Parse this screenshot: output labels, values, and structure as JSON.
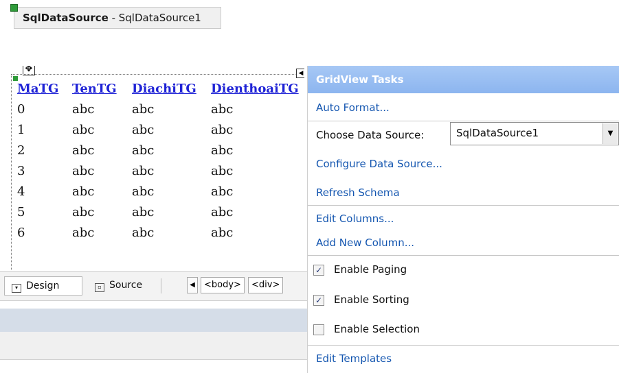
{
  "data_source": {
    "type": "SqlDataSource",
    "name": "SqlDataSource1",
    "separator": " - "
  },
  "grid": {
    "columns": [
      "MaTG",
      "TenTG",
      "DiachiTG",
      "DienthoaiTG"
    ],
    "rows": [
      [
        "0",
        "abc",
        "abc",
        "abc"
      ],
      [
        "1",
        "abc",
        "abc",
        "abc"
      ],
      [
        "2",
        "abc",
        "abc",
        "abc"
      ],
      [
        "3",
        "abc",
        "abc",
        "abc"
      ],
      [
        "4",
        "abc",
        "abc",
        "abc"
      ],
      [
        "5",
        "abc",
        "abc",
        "abc"
      ],
      [
        "6",
        "abc",
        "abc",
        "abc"
      ]
    ]
  },
  "view_bar": {
    "design_label": "Design",
    "source_label": "Source",
    "crumbs": [
      "<body>",
      "<div>"
    ]
  },
  "tasks": {
    "title": "GridView Tasks",
    "auto_format": "Auto Format...",
    "choose_ds_label": "Choose Data Source:",
    "choose_ds_value": "SqlDataSource1",
    "configure_ds": "Configure Data Source...",
    "refresh_schema": "Refresh Schema",
    "edit_columns": "Edit Columns...",
    "add_column": "Add New Column...",
    "enable_paging": {
      "label": "Enable Paging",
      "checked": true
    },
    "enable_sorting": {
      "label": "Enable Sorting",
      "checked": true
    },
    "enable_selection": {
      "label": "Enable Selection",
      "checked": false
    },
    "edit_templates": "Edit Templates"
  },
  "colors": {
    "header_bg": "#a7c8f5",
    "link": "#1456b0",
    "grid_header": "#1f23d6"
  }
}
